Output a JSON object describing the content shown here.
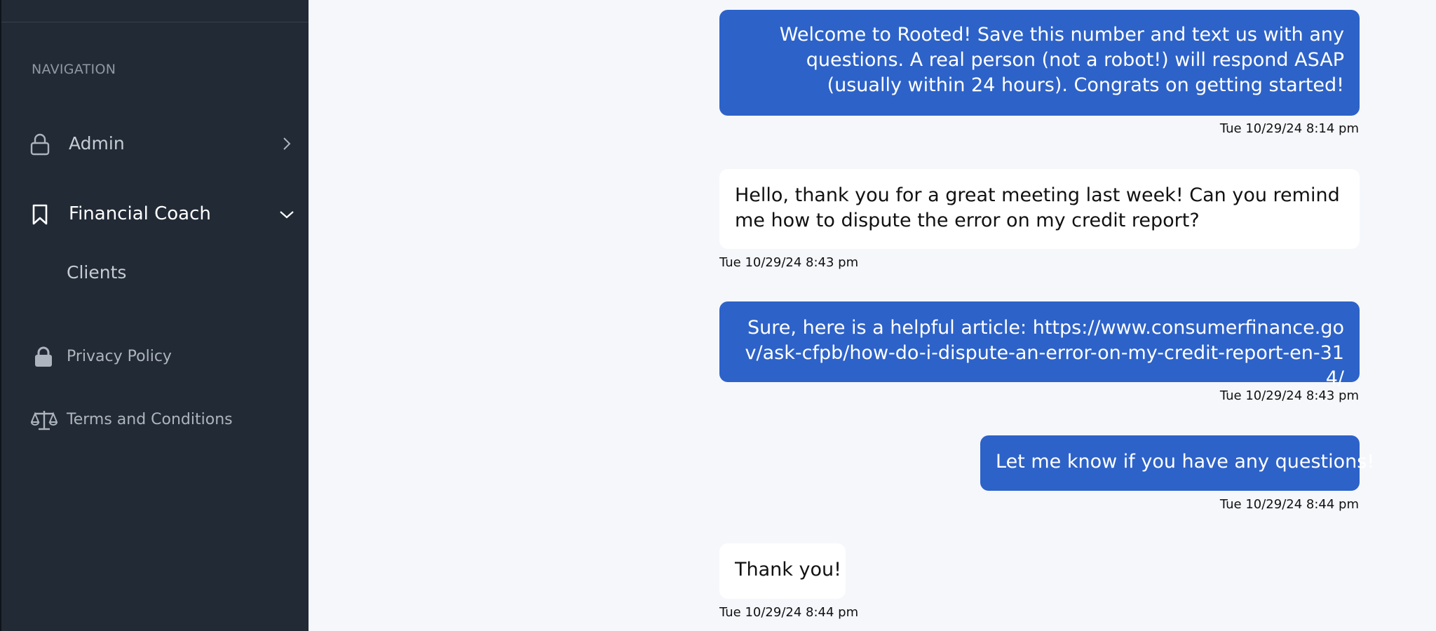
{
  "sidebar": {
    "heading": "NAVIGATION",
    "items": [
      {
        "label": "Admin",
        "icon": "lock-icon"
      },
      {
        "label": "Financial Coach",
        "icon": "bookmark-icon"
      },
      {
        "label": "Clients"
      },
      {
        "label": "Privacy Policy",
        "icon": "lock-icon"
      },
      {
        "label": "Terms and Conditions",
        "icon": "scale-icon"
      }
    ]
  },
  "messages": [
    {
      "direction": "outgoing",
      "text": "Welcome to Rooted! Save this number and text us with any questions. A real person (not a robot!) will respond ASAP (usually within 24 hours). Congrats on getting started!",
      "time": "Tue 10/29/24 8:14 pm"
    },
    {
      "direction": "incoming",
      "text": "Hello, thank you for a great meeting last week! Can you remind me how to dispute the error on my credit report?",
      "time": "Tue 10/29/24 8:43 pm"
    },
    {
      "direction": "outgoing",
      "text": "Sure, here is a helpful article: https://www.consumerfinance.gov/ask-cfpb/how-do-i-dispute-an-error-on-my-credit-report-en-314/",
      "time": "Tue 10/29/24 8:43 pm"
    },
    {
      "direction": "outgoing",
      "text": "Let me know if you have any questions!",
      "time": "Tue 10/29/24 8:44 pm"
    },
    {
      "direction": "incoming",
      "text": "Thank you!",
      "time": "Tue 10/29/24 8:44 pm"
    }
  ],
  "colors": {
    "sidebar_bg": "#222a35",
    "outgoing_bubble": "#2d62c8",
    "incoming_bubble": "#ffffff",
    "page_bg": "#f5f7fb"
  }
}
